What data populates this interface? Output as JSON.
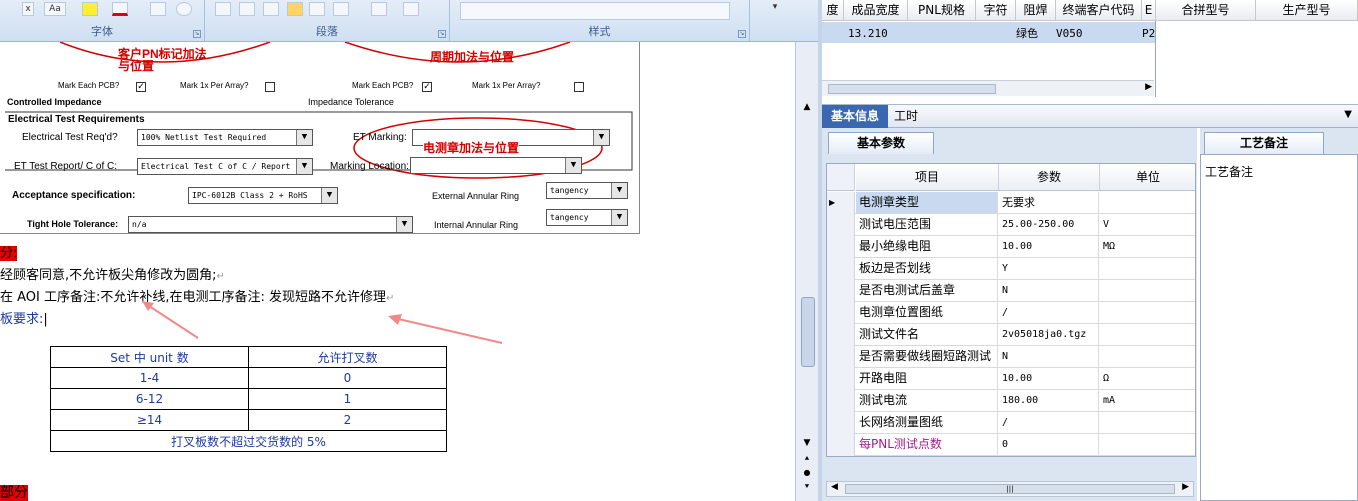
{
  "ribbon": {
    "groups": [
      {
        "label": "字体"
      },
      {
        "label": "段落"
      },
      {
        "label": "样式"
      }
    ],
    "font_buttons": [
      "x",
      "Aa"
    ]
  },
  "doc_form": {
    "stamp_left": "客户PN标记加法\n与位置",
    "stamp_right": "周期加法与位置",
    "mark_each_pcb_left": "Mark Each PCB?",
    "mark_per_array_left": "Mark 1x Per Array?",
    "mark_each_pcb_right": "Mark Each PCB?",
    "mark_per_array_right": "Mark 1x Per Array?",
    "controlled_impedance": "Controlled Impedance",
    "impedance_tolerance": "Impedance Tolerance",
    "electrical_test_requirements": "Electrical Test Requirements",
    "electrical_test_reqd_label": "Electrical Test Req'd?",
    "electrical_test_reqd_value": "100% Netlist Test Required",
    "et_marking_label": "ET Marking:",
    "et_stamp": "电测章加法与位置",
    "et_report_label": "ET Test Report/ C of C:",
    "et_report_value": "Electrical Test C of C / Report",
    "marking_location_label": "Marking Location:",
    "acceptance_label": "Acceptance specification:",
    "acceptance_value": "IPC-6012B Class 2 + RoHS",
    "external_ring_label": "External Annular Ring",
    "external_ring_value": "tangency",
    "tight_hole_label": "Tight Hole Tolerance:",
    "tight_hole_value": "n/a",
    "internal_ring_label": "Internal Annular Ring",
    "internal_ring_value": "tangency"
  },
  "doc_text": {
    "line1": "分:",
    "line2": "经顾客同意,不允许板尖角修改为圆角;",
    "line3": "在 AOI 工序备注:不允许补线,在电测工序备注: 发现短路不允许修理",
    "line4": "板要求:",
    "bottom": "部分"
  },
  "doc_table": {
    "headers": [
      "Set 中 unit 数",
      "允许打叉数"
    ],
    "rows": [
      [
        "1-4",
        "0"
      ],
      [
        "6-12",
        "1"
      ],
      [
        "≥14",
        "2"
      ]
    ],
    "footer": "打叉板数不超过交货数的 5%"
  },
  "top_grid": {
    "headers": [
      "度",
      "成品宽度",
      "PNL规格",
      "字符",
      "阻焊",
      "终端客户代码",
      "E"
    ],
    "row": {
      "width": "13.210",
      "solder": "绿色",
      "code": "V050",
      "e": "P2"
    },
    "right_headers": [
      "合拼型号",
      "生产型号"
    ]
  },
  "tabs": [
    "基本信息",
    "工时"
  ],
  "subtabs": {
    "left": "基本参数",
    "right": "工艺备注"
  },
  "remark_label": "工艺备注",
  "param_grid": {
    "headers": [
      "项目",
      "参数",
      "单位"
    ],
    "rows": [
      {
        "item": "电测章类型",
        "value": "无要求",
        "unit": ""
      },
      {
        "item": "测试电压范围",
        "value": "25.00-250.00",
        "unit": "V"
      },
      {
        "item": "最小绝缘电阻",
        "value": "10.00",
        "unit": "MΩ"
      },
      {
        "item": "板边是否划线",
        "value": "Y",
        "unit": ""
      },
      {
        "item": "是否电测试后盖章",
        "value": "N",
        "unit": ""
      },
      {
        "item": "电测章位置图纸",
        "value": "/",
        "unit": ""
      },
      {
        "item": "测试文件名",
        "value": "2v05018ja0.tgz",
        "unit": ""
      },
      {
        "item": "是否需要做线圈短路测试",
        "value": "N",
        "unit": ""
      },
      {
        "item": "开路电阻",
        "value": "10.00",
        "unit": "Ω"
      },
      {
        "item": "测试电流",
        "value": "180.00",
        "unit": "mA"
      },
      {
        "item": "长网络测量图纸",
        "value": "/",
        "unit": ""
      },
      {
        "item": "每PNL测试点数",
        "value": "0",
        "unit": ""
      }
    ]
  },
  "colors": {
    "highlight": "#e00000",
    "annotation": "#d40000",
    "arrow": "#f08a8a",
    "link_purple": "#a0208f"
  }
}
